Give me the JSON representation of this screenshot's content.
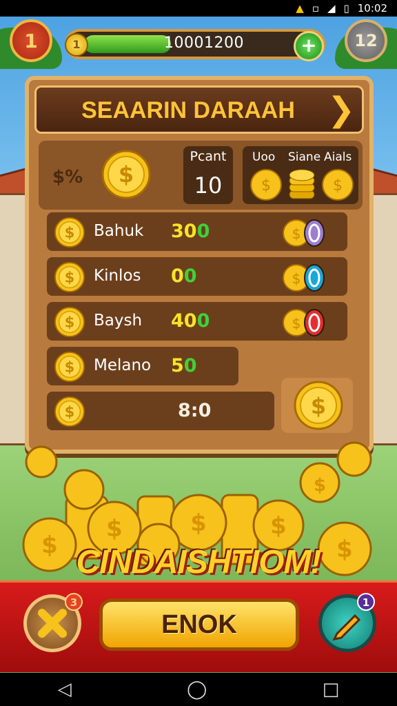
{
  "status_bar": {
    "time": "10:02"
  },
  "hud": {
    "level": "1",
    "coin_icon_label": "1",
    "coins": "10001200",
    "coin_bar_fill_fraction": 0.37,
    "right_badge": "12"
  },
  "panel": {
    "title": "SEAARIN DARAAH",
    "summary": {
      "symbol_text": "$%",
      "box_label": "Pcant",
      "box_value": "10",
      "labels": [
        "Uoo",
        "Siane",
        "Aials"
      ]
    },
    "rows": [
      {
        "name": "Bahuk",
        "value_yellow": "30",
        "value_green": "0",
        "badge_color": "#9c7fd0"
      },
      {
        "name": "Kinlos",
        "value_yellow": "0",
        "value_green": "0",
        "badge_color": "#1aa6d6"
      },
      {
        "name": "Baysh",
        "value_yellow": "40",
        "value_green": "0",
        "badge_color": "#e03030"
      },
      {
        "name": "Melano",
        "value_yellow": "5",
        "value_green": "0"
      },
      {
        "name": "",
        "value_text": "8:0"
      }
    ]
  },
  "banner": "CINDAISHTIOM!",
  "bottom": {
    "ok_label": "ENOK",
    "close_badge": "3",
    "edit_badge": "1"
  },
  "colors": {
    "gold": "#ffc438",
    "panel_wood": "#b97a3d",
    "bottom_red": "#d81b1b"
  },
  "icons": [
    "wifi-icon",
    "vibrate-icon",
    "signal-icon",
    "battery-icon",
    "plus-icon",
    "coin-icon",
    "arrow-right-icon",
    "close-icon",
    "pencil-icon",
    "back-icon",
    "home-icon",
    "recents-icon"
  ]
}
